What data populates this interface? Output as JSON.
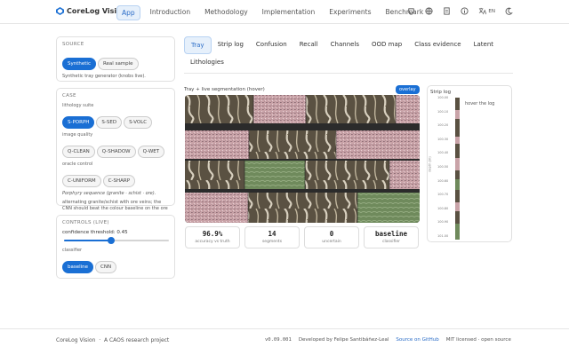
{
  "app": {
    "name": "CoreLog Vision"
  },
  "nav": {
    "links": [
      "App",
      "Introduction",
      "Methodology",
      "Implementation",
      "Experiments",
      "Benchmark"
    ],
    "lang": "EN"
  },
  "source": {
    "title": "SOURCE",
    "options": [
      "Synthetic",
      "Real sample"
    ],
    "selected": "Synthetic",
    "note": "Synthetic tray generator (knobs live)."
  },
  "case": {
    "title": "CASE",
    "lithology_label": "lithology suite",
    "lithology": [
      "S-PORPH",
      "S-SED",
      "S-VOLC"
    ],
    "quality_label": "image quality",
    "quality": [
      "Q-CLEAN",
      "Q-SHADOW",
      "Q-WET"
    ],
    "oracle_label": "oracle control",
    "oracle": [
      "C-UNIFORM",
      "C-SHARP"
    ],
    "desc1": "Porphyry sequence (granite · schist · ore).",
    "desc2": "alternating granite/schist with ore veins; the CNN should beat the colour baseline on the ore"
  },
  "controls": {
    "title": "CONTROLS (LIVE)",
    "conf_label": "confidence threshold: 0.45",
    "confidence": 0.45,
    "classifier_label": "classifier",
    "classifiers": [
      "baseline",
      "CNN"
    ]
  },
  "tabs": [
    "Tray",
    "Strip log",
    "Confusion",
    "Recall",
    "Channels",
    "OOD map",
    "Class evidence",
    "Latent",
    "Lithologies"
  ],
  "tray": {
    "caption": "Tray + live segmentation (hover)",
    "overlay": "overlay"
  },
  "stats": [
    {
      "value": "96.9%",
      "label": "accuracy vs truth"
    },
    {
      "value": "14",
      "label": "segments"
    },
    {
      "value": "0",
      "label": "uncertain"
    },
    {
      "value": "baseline",
      "label": "classifier"
    }
  ],
  "strip": {
    "title": "Strip log",
    "hint": "hover the log",
    "axis": "depth (m)",
    "ticks": [
      "100.00",
      "100.10",
      "100.20",
      "100.30",
      "100.40",
      "100.50",
      "100.60",
      "100.70",
      "100.80",
      "100.90",
      "101.00"
    ]
  },
  "footer": {
    "left": "CoreLog Vision  ·  A CAOS research project",
    "version": "v0.09.001",
    "dev": "Developed by Felipe Santibáñez-Leal",
    "github": "Source on GitHub",
    "license": "MIT licensed · open source"
  },
  "colors": {
    "accent": "#1a6fd4",
    "granite": "#c9a3a8",
    "schist": "#5a5142",
    "ore": "#6f8a5c",
    "gap": "#2b2b2b"
  }
}
